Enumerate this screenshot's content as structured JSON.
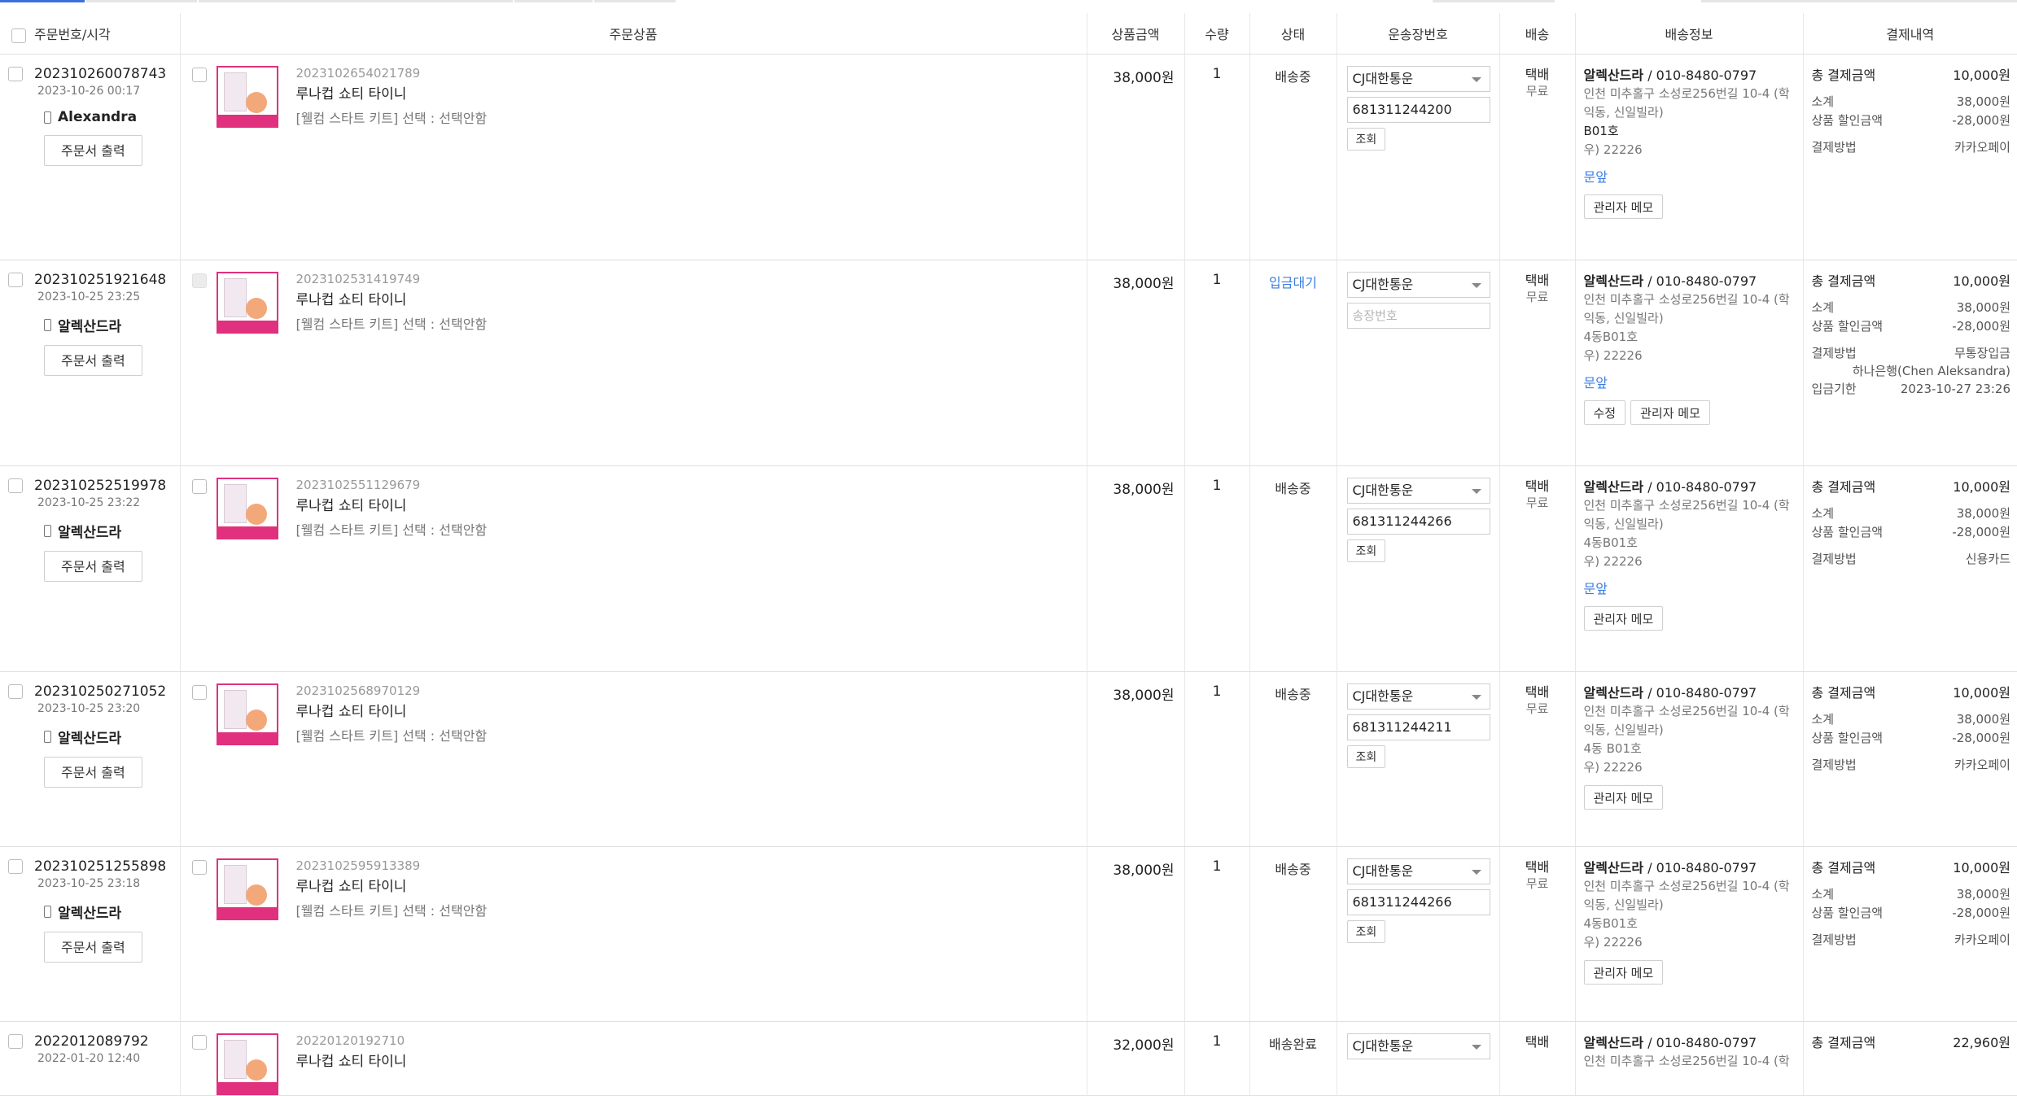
{
  "headers": {
    "order": "주문번호/시각",
    "product": "주문상품",
    "price": "상품금액",
    "qty": "수량",
    "status": "상태",
    "courier": "운송장번호",
    "ship": "배송",
    "address": "배송정보",
    "payment": "결제내역"
  },
  "labels": {
    "print_order": "주문서 출력",
    "lookup": "조회",
    "admin_memo": "관리자 메모",
    "edit": "수정",
    "total_paid": "총 결제금액",
    "subtotal": "소계",
    "discount": "상품 할인금액",
    "method": "결제방법",
    "deadline": "입금기한",
    "invoice_placeholder": "송장번호"
  },
  "orders": [
    {
      "order_no": "202310260078743",
      "datetime": "2023-10-26 00:17",
      "buyer": "Alexandra",
      "item_no": "2023102654021789",
      "product": "루나컵 쇼티 타이니",
      "option": "[웰컴 스타트 키트] 선택 : 선택안함",
      "price": "38,000원",
      "qty": "1",
      "status": "배송중",
      "courier": "CJ대한통운",
      "invoice": "681311244200",
      "ship_type": "택배",
      "ship_fee": "무료",
      "recipient": "알렉산드라",
      "phone": "010-8480-0797",
      "addr1": "인천 미추홀구 소성로256번길 10-4 (학",
      "addr2": "익동, 신일빌라)",
      "addr3": "B01호",
      "zip": "우) 22226",
      "memo": "문앞",
      "total": "10,000원",
      "subtotal": "38,000원",
      "discount": "-28,000원",
      "method": "카카오페이"
    },
    {
      "order_no": "202310251921648",
      "datetime": "2023-10-25 23:25",
      "buyer": "알렉산드라",
      "item_no": "2023102531419749",
      "product": "루나컵 쇼티 타이니",
      "option": "[웰컴 스타트 키트] 선택 : 선택안함",
      "price": "38,000원",
      "qty": "1",
      "status": "입금대기",
      "courier": "CJ대한통운",
      "invoice": "",
      "ship_type": "택배",
      "ship_fee": "무료",
      "recipient": "알렉산드라",
      "phone": "010-8480-0797",
      "addr1": "인천 미추홀구 소성로256번길 10-4 (학",
      "addr2": "익동, 신일빌라)",
      "addr3": "4동B01호",
      "zip": "우) 22226",
      "memo": "문앞",
      "total": "10,000원",
      "subtotal": "38,000원",
      "discount": "-28,000원",
      "method": "무통장입금",
      "bank": "하나은행(Chen Aleksandra)",
      "deadline_value": "2023-10-27 23:26"
    },
    {
      "order_no": "202310252519978",
      "datetime": "2023-10-25 23:22",
      "buyer": "알렉산드라",
      "item_no": "2023102551129679",
      "product": "루나컵 쇼티 타이니",
      "option": "[웰컴 스타트 키트] 선택 : 선택안함",
      "price": "38,000원",
      "qty": "1",
      "status": "배송중",
      "courier": "CJ대한통운",
      "invoice": "681311244266",
      "ship_type": "택배",
      "ship_fee": "무료",
      "recipient": "알렉산드라",
      "phone": "010-8480-0797",
      "addr1": "인천 미추홀구 소성로256번길 10-4 (학",
      "addr2": "익동, 신일빌라)",
      "addr3": "4동B01호",
      "zip": "우) 22226",
      "memo": "문앞",
      "total": "10,000원",
      "subtotal": "38,000원",
      "discount": "-28,000원",
      "method": "신용카드"
    },
    {
      "order_no": "202310250271052",
      "datetime": "2023-10-25 23:20",
      "buyer": "알렉산드라",
      "item_no": "2023102568970129",
      "product": "루나컵 쇼티 타이니",
      "option": "[웰컴 스타트 키트] 선택 : 선택안함",
      "price": "38,000원",
      "qty": "1",
      "status": "배송중",
      "courier": "CJ대한통운",
      "invoice": "681311244211",
      "ship_type": "택배",
      "ship_fee": "무료",
      "recipient": "알렉산드라",
      "phone": "010-8480-0797",
      "addr1": "인천 미추홀구 소성로256번길 10-4 (학",
      "addr2": "익동, 신일빌라)",
      "addr3": "4동 B01호",
      "zip": "우) 22226",
      "total": "10,000원",
      "subtotal": "38,000원",
      "discount": "-28,000원",
      "method": "카카오페이"
    },
    {
      "order_no": "202310251255898",
      "datetime": "2023-10-25 23:18",
      "buyer": "알렉산드라",
      "item_no": "2023102595913389",
      "product": "루나컵 쇼티 타이니",
      "option": "[웰컴 스타트 키트] 선택 : 선택안함",
      "price": "38,000원",
      "qty": "1",
      "status": "배송중",
      "courier": "CJ대한통운",
      "invoice": "681311244266",
      "ship_type": "택배",
      "ship_fee": "무료",
      "recipient": "알렉산드라",
      "phone": "010-8480-0797",
      "addr1": "인천 미추홀구 소성로256번길 10-4 (학",
      "addr2": "익동, 신일빌라)",
      "addr3": "4동B01호",
      "zip": "우) 22226",
      "total": "10,000원",
      "subtotal": "38,000원",
      "discount": "-28,000원",
      "method": "카카오페이"
    },
    {
      "order_no": "2022012089792",
      "datetime": "2022-01-20 12:40",
      "item_no": "20220120192710",
      "product": "루나컵 쇼티 타이니",
      "price": "32,000원",
      "qty": "1",
      "status": "배송완료",
      "courier": "CJ대한통운",
      "ship_type": "택배",
      "recipient": "알렉산드라",
      "phone": "010-8480-0797",
      "addr1": "인천 미추홀구 소성로256번길 10-4 (학",
      "total": "22,960원"
    }
  ]
}
